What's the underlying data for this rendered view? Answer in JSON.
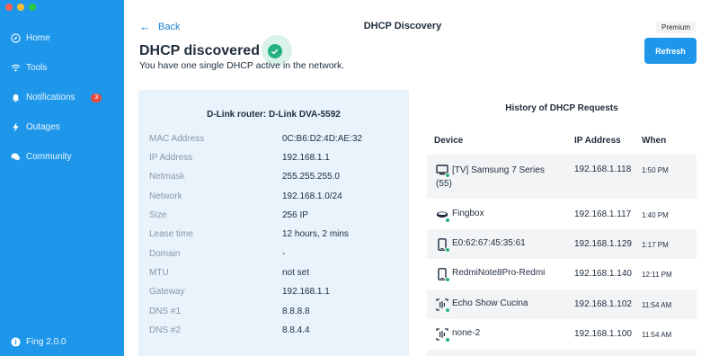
{
  "sidebar": {
    "traffic_colors": [
      "#ff5f57",
      "#febc2e",
      "#28c840"
    ],
    "items": [
      {
        "label": "Home",
        "icon": "compass-icon"
      },
      {
        "label": "Tools",
        "icon": "wifi-icon"
      },
      {
        "label": "Notifications",
        "icon": "bell-icon",
        "badge": "3"
      },
      {
        "label": "Outages",
        "icon": "bolt-icon"
      },
      {
        "label": "Community",
        "icon": "chat-icon"
      }
    ],
    "version": "Fing 2.0.0"
  },
  "header": {
    "back_label": "Back",
    "title": "DHCP Discovery",
    "premium_label": "Premium",
    "refresh_label": "Refresh"
  },
  "main": {
    "title": "DHCP discovered",
    "subtitle": "You have one single DHCP active in the network."
  },
  "router_card": {
    "title": "D-Link router: D-Link DVA-5592",
    "rows": [
      {
        "key": "MAC Address",
        "value": "0C:B6:D2:4D:AE:32"
      },
      {
        "key": "IP Address",
        "value": "192.168.1.1"
      },
      {
        "key": "Netmask",
        "value": "255.255.255.0"
      },
      {
        "key": "Network",
        "value": "192.168.1.0/24"
      },
      {
        "key": "Size",
        "value": "256 IP"
      },
      {
        "key": "Lease time",
        "value": "12 hours, 2 mins"
      },
      {
        "key": "Domain",
        "value": "-"
      },
      {
        "key": "MTU",
        "value": "not set"
      },
      {
        "key": "Gateway",
        "value": "192.168.1.1"
      },
      {
        "key": "DNS #1",
        "value": "8.8.8.8"
      },
      {
        "key": "DNS #2",
        "value": "8.8.4.4"
      }
    ]
  },
  "history": {
    "title": "History of DHCP Requests",
    "columns": [
      "Device",
      "IP Address",
      "When"
    ],
    "rows": [
      {
        "device_line1": "[TV] Samsung 7 Series",
        "device_line2": "(55)",
        "icon": "tv-icon",
        "ip": "192.168.1.118",
        "when": "1:50 PM"
      },
      {
        "device_line1": "Fingbox",
        "device_line2": "",
        "icon": "fingbox-icon",
        "ip": "192.168.1.117",
        "when": "1:40 PM"
      },
      {
        "device_line1": "E0:62:67:45:35:61",
        "device_line2": "",
        "icon": "phone-icon",
        "ip": "192.168.1.129",
        "when": "1:17 PM"
      },
      {
        "device_line1": "RedmiNote8Pro-Redmi",
        "device_line2": "",
        "icon": "phone-icon",
        "ip": "192.168.1.140",
        "when": "12:11 PM"
      },
      {
        "device_line1": "Echo Show Cucina",
        "device_line2": "",
        "icon": "voice-assistant-icon",
        "ip": "192.168.1.102",
        "when": "11:54 AM"
      },
      {
        "device_line1": "none-2",
        "device_line2": "",
        "icon": "voice-assistant-icon",
        "ip": "192.168.1.100",
        "when": "11:54 AM"
      }
    ]
  }
}
